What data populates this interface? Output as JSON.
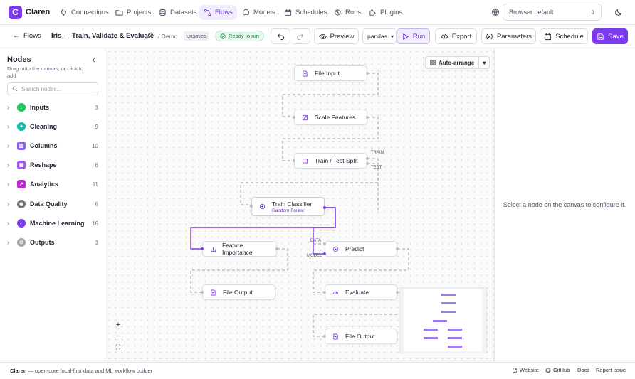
{
  "app": {
    "logo_letter": "C",
    "name": "Claren"
  },
  "nav": [
    {
      "label": "Connections",
      "icon": "plug-icon"
    },
    {
      "label": "Projects",
      "icon": "folder-icon"
    },
    {
      "label": "Datasets",
      "icon": "database-icon"
    },
    {
      "label": "Flows",
      "icon": "flow-icon",
      "active": true
    },
    {
      "label": "Models",
      "icon": "brain-icon"
    },
    {
      "label": "Schedules",
      "icon": "calendar-icon"
    },
    {
      "label": "Runs",
      "icon": "history-icon"
    },
    {
      "label": "Plugins",
      "icon": "puzzle-icon"
    }
  ],
  "locale": {
    "value": "Browser default"
  },
  "toolbar": {
    "back_label": "Flows",
    "flow_title": "Iris — Train, Validate & Evaluate",
    "folder": "/ Demo",
    "unsaved": "unsaved",
    "status": "Ready to run",
    "preview": "Preview",
    "engine": "pandas",
    "run": "Run",
    "export": "Export",
    "parameters": "Parameters",
    "schedule": "Schedule",
    "save": "Save"
  },
  "sidebar": {
    "title": "Nodes",
    "hint": "Drag onto the canvas, or click to add",
    "search_placeholder": "Search nodes...",
    "categories": [
      {
        "label": "Inputs",
        "count": "3",
        "color": "#22c55e"
      },
      {
        "label": "Cleaning",
        "count": "9",
        "color": "#14b8a6"
      },
      {
        "label": "Columns",
        "count": "10",
        "color": "#8b5cf6"
      },
      {
        "label": "Reshape",
        "count": "6",
        "color": "#a855f7"
      },
      {
        "label": "Analytics",
        "count": "11",
        "color": "#c026d3"
      },
      {
        "label": "Data Quality",
        "count": "6",
        "color": "#6b7280"
      },
      {
        "label": "Machine Learning",
        "count": "16",
        "color": "#7c3aed"
      },
      {
        "label": "Outputs",
        "count": "3",
        "color": "#9ca3af"
      }
    ]
  },
  "canvas": {
    "auto_arrange": "Auto-arrange",
    "nodes": {
      "file_input": "File Input",
      "scale_features": "Scale Features",
      "train_test_split": "Train / Test Split",
      "train_classifier": "Train Classifier",
      "train_classifier_sub": "Random Forest",
      "feature_importance": "Feature Importance",
      "predict": "Predict",
      "file_output_1": "File Output",
      "evaluate": "Evaluate",
      "file_output_2": "File Output"
    },
    "ports": {
      "train": "TRAIN",
      "test": "TEST",
      "data": "DATA",
      "model": "MODEL"
    },
    "zoom_in": "+",
    "zoom_out": "−",
    "fit": "⛶"
  },
  "right_panel": {
    "hint": "Select a node on the canvas to configure it."
  },
  "footer": {
    "brand": "Claren",
    "tagline": " — open-core local-first data and ML workflow builder",
    "links": [
      "Website",
      "GitHub",
      "Docs",
      "Report issue"
    ]
  },
  "colors": {
    "accent": "#7c3aed",
    "edge_active": "#7c3aed",
    "edge_idle": "#9aa0ab"
  }
}
